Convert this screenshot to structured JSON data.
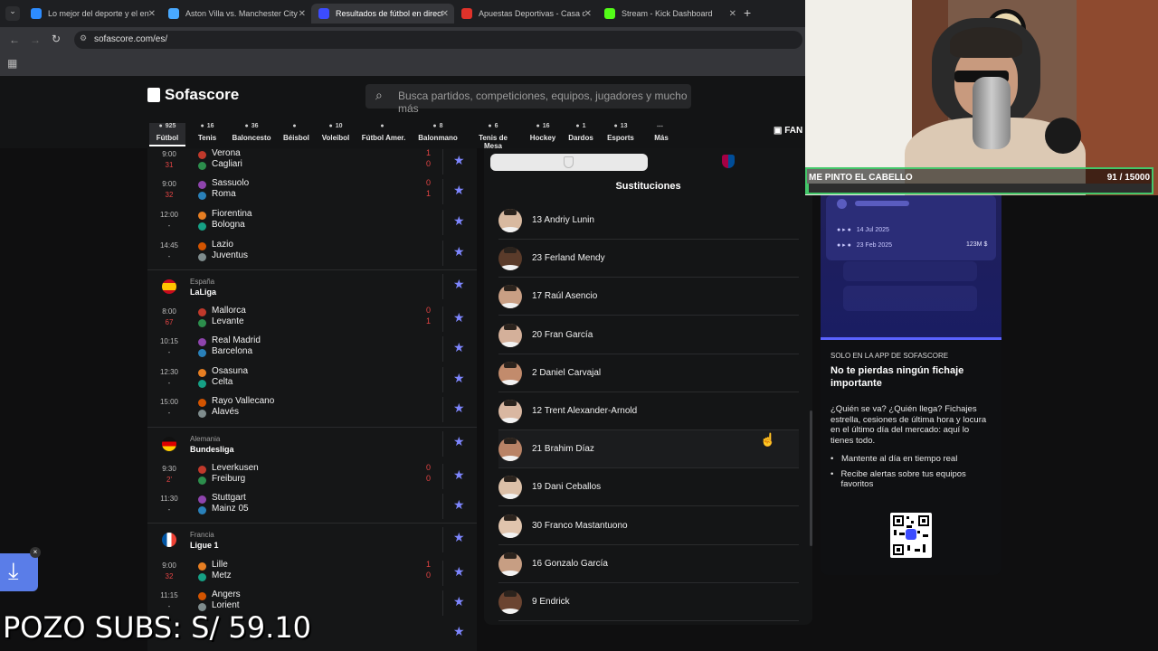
{
  "browser": {
    "tabs": [
      {
        "title": "Lo mejor del deporte y el entre",
        "favicon": "dazn-icon",
        "color": "#2d8cff"
      },
      {
        "title": "Aston Villa vs. Manchester City",
        "favicon": "rocket-icon",
        "color": "#49a9ff"
      },
      {
        "title": "Resultados de fútbol en directo",
        "favicon": "sofascore-icon",
        "color": "#3c4cff",
        "active": true
      },
      {
        "title": "Apuestas Deportivas - Casa de",
        "favicon": "bet-icon",
        "color": "#e0322a"
      },
      {
        "title": "Stream - Kick Dashboard",
        "favicon": "kick-icon",
        "color": "#53fc18"
      }
    ],
    "url": "sofascore.com/es/"
  },
  "site": {
    "logo": "Sofascore",
    "search_placeholder": "Busca partidos, competiciones, equipos, jugadores y mucho más",
    "sports": [
      {
        "label": "Fútbol",
        "count": "925",
        "active": true
      },
      {
        "label": "Tenis",
        "count": "16"
      },
      {
        "label": "Baloncesto",
        "count": "36"
      },
      {
        "label": "Béisbol",
        "count": ""
      },
      {
        "label": "Voleibol",
        "count": "10"
      },
      {
        "label": "Fútbol Amer.",
        "count": ""
      },
      {
        "label": "Balonmano",
        "count": "8"
      },
      {
        "label": "Tenis de Mesa",
        "count": "6"
      },
      {
        "label": "Hockey",
        "count": "16"
      },
      {
        "label": "Dardos",
        "count": "1"
      },
      {
        "label": "Esports",
        "count": "13"
      },
      {
        "label": "Más",
        "count": ""
      }
    ],
    "fan_label": "FAN"
  },
  "matches": {
    "italy": [
      {
        "time": "9:00",
        "status": "31",
        "home": "Verona",
        "away": "Cagliari",
        "hs": "1",
        "as": "0"
      },
      {
        "time": "9:00",
        "status": "32",
        "home": "Sassuolo",
        "away": "Roma",
        "hs": "0",
        "as": "1"
      },
      {
        "time": "12:00",
        "status": "-",
        "home": "Fiorentina",
        "away": "Bologna",
        "hs": "",
        "as": ""
      },
      {
        "time": "14:45",
        "status": "-",
        "home": "Lazio",
        "away": "Juventus",
        "hs": "",
        "as": ""
      }
    ],
    "spain": {
      "country": "España",
      "league": "LaLiga",
      "rows": [
        {
          "time": "8:00",
          "status": "67",
          "home": "Mallorca",
          "away": "Levante",
          "hs": "0",
          "as": "1"
        },
        {
          "time": "10:15",
          "status": "-",
          "home": "Real Madrid",
          "away": "Barcelona",
          "hs": "",
          "as": ""
        },
        {
          "time": "12:30",
          "status": "-",
          "home": "Osasuna",
          "away": "Celta",
          "hs": "",
          "as": ""
        },
        {
          "time": "15:00",
          "status": "-",
          "home": "Rayo Vallecano",
          "away": "Alavés",
          "hs": "",
          "as": ""
        }
      ]
    },
    "germany": {
      "country": "Alemania",
      "league": "Bundesliga",
      "rows": [
        {
          "time": "9:30",
          "status": "2'",
          "home": "Leverkusen",
          "away": "Freiburg",
          "hs": "0",
          "as": "0"
        },
        {
          "time": "11:30",
          "status": "-",
          "home": "Stuttgart",
          "away": "Mainz 05",
          "hs": "",
          "as": ""
        }
      ]
    },
    "france": {
      "country": "Francia",
      "league": "Ligue 1",
      "rows": [
        {
          "time": "9:00",
          "status": "32",
          "home": "Lille",
          "away": "Metz",
          "hs": "1",
          "as": "0"
        },
        {
          "time": "11:15",
          "status": "-",
          "home": "Angers",
          "away": "Lorient",
          "hs": "",
          "as": ""
        }
      ]
    }
  },
  "substitutions": {
    "title": "Sustituciones",
    "players": [
      "13 Andriy Lunin",
      "23 Ferland Mendy",
      "17 Raúl Asencio",
      "20 Fran García",
      "2 Daniel Carvajal",
      "12 Trent Alexander-Arnold",
      "21 Brahim Díaz",
      "19 Dani Ceballos",
      "30 Franco Mastantuono",
      "16 Gonzalo García",
      "9 Endrick"
    ]
  },
  "promo": {
    "date1": "14 Jul 2025",
    "date2": "23 Feb 2025",
    "value": "123M $",
    "eyebrow": "SOLO EN LA APP DE SOFASCORE",
    "heading": "No te pierdas ningún fichaje importante",
    "body": "¿Quién se va? ¿Quién llega? Fichajes estrella, cesiones de última hora y locura en el último día del mercado: aquí lo tienes todo.",
    "bullets": [
      "Mantente al día en tiempo real",
      "Recibe alertas sobre tus equipos favoritos"
    ]
  },
  "stream": {
    "cam_label": "ME PINTO EL CABELLO",
    "goal": "91 / 15000",
    "goal_progress": 0.006,
    "subs_overlay": "POZO SUBS: S/ 59.10"
  }
}
